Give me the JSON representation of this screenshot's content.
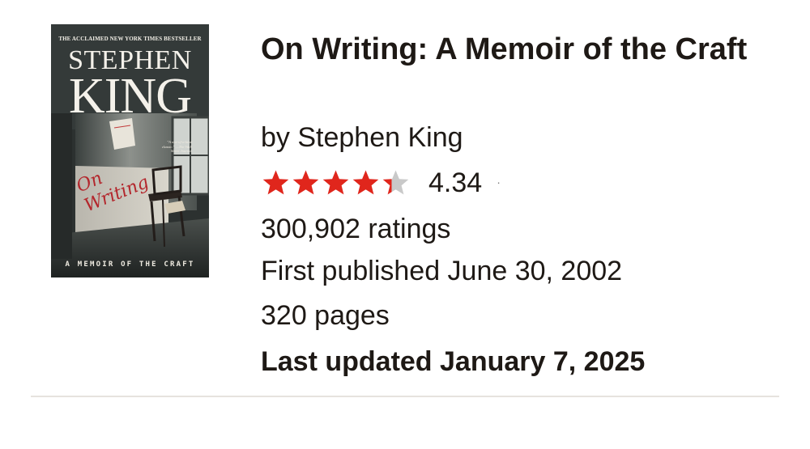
{
  "book": {
    "title": "On Writing: A Memoir of the Craft",
    "by_prefix": "by ",
    "author": "Stephen King",
    "rating": {
      "value": 4.34,
      "value_label": "4.34",
      "max_stars": 5,
      "separator": "·",
      "star_color": "#e0261c",
      "star_empty_color": "#c9c9c9"
    },
    "ratings_count": "300,902 ratings",
    "first_published": "First published June 30, 2002",
    "pages": "320 pages",
    "last_updated": "Last updated January 7, 2025"
  },
  "cover": {
    "tagline": "THE ACCLAIMED NEW YORK TIMES BESTSELLER",
    "author_first": "STEPHEN",
    "author_last": "KING",
    "title_line1": "On",
    "title_line2": "Writing",
    "quote": "\"A one-of-a-kind classic.\" —The Wall Street Journal",
    "subtitle": "A MEMOIR OF THE CRAFT"
  },
  "colors": {
    "text": "#1e1915",
    "divider": "#e6e3de",
    "cover_title_red": "#b3262c"
  }
}
